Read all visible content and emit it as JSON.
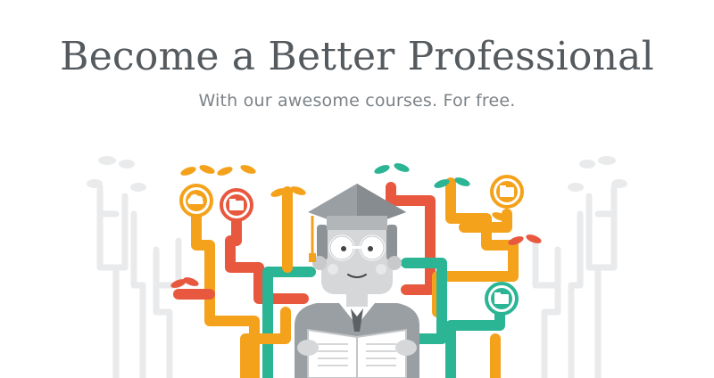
{
  "hero": {
    "title": "Become a Better Professional",
    "subtitle": "With our awesome courses. For free."
  },
  "illustration": {
    "icons": [
      "cloud-icon",
      "folder-icon",
      "folder-icon",
      "folder-icon"
    ],
    "colors": {
      "orange": "#f4a21c",
      "red": "#e8583f",
      "teal": "#2bb594",
      "gray_tree": "#e9eaeb",
      "graduate_gray": "#9a9fa3"
    }
  }
}
